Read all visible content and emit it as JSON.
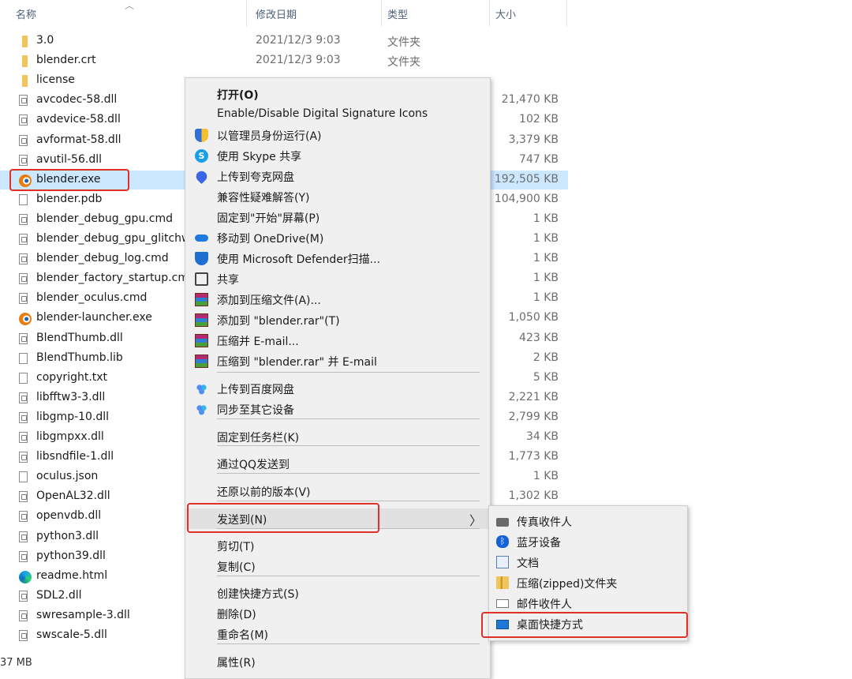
{
  "columns": {
    "name": "名称",
    "date": "修改日期",
    "type": "类型",
    "size": "大小"
  },
  "files": [
    {
      "name": "3.0",
      "date": "2021/12/3 9:03",
      "type": "文件夹",
      "size": "",
      "icon": "folder-icon"
    },
    {
      "name": "blender.crt",
      "date": "2021/12/3 9:03",
      "type": "文件夹",
      "size": "",
      "icon": "folder-icon"
    },
    {
      "name": "license",
      "date": "",
      "type": "",
      "size": "",
      "icon": "folder-icon"
    },
    {
      "name": "avcodec-58.dll",
      "date": "",
      "type": "",
      "size": "21,470 KB",
      "icon": "dll-file-icon"
    },
    {
      "name": "avdevice-58.dll",
      "date": "",
      "type": "",
      "size": "102 KB",
      "icon": "dll-file-icon"
    },
    {
      "name": "avformat-58.dll",
      "date": "",
      "type": "",
      "size": "3,379 KB",
      "icon": "dll-file-icon"
    },
    {
      "name": "avutil-56.dll",
      "date": "",
      "type": "",
      "size": "747 KB",
      "icon": "dll-file-icon"
    },
    {
      "name": "blender.exe",
      "date": "",
      "type": "",
      "size": "192,505 KB",
      "icon": "blender-icon"
    },
    {
      "name": "blender.pdb",
      "date": "",
      "type": "",
      "size": "104,900 KB",
      "icon": "file-icon"
    },
    {
      "name": "blender_debug_gpu.cmd",
      "date": "",
      "type": "",
      "size": "1 KB",
      "icon": "cmd-file-icon"
    },
    {
      "name": "blender_debug_gpu_glitchw",
      "date": "",
      "type": "",
      "size": "1 KB",
      "icon": "cmd-file-icon"
    },
    {
      "name": "blender_debug_log.cmd",
      "date": "",
      "type": "",
      "size": "1 KB",
      "icon": "cmd-file-icon"
    },
    {
      "name": "blender_factory_startup.cmc",
      "date": "",
      "type": "",
      "size": "1 KB",
      "icon": "cmd-file-icon"
    },
    {
      "name": "blender_oculus.cmd",
      "date": "",
      "type": "",
      "size": "1 KB",
      "icon": "cmd-file-icon"
    },
    {
      "name": "blender-launcher.exe",
      "date": "",
      "type": "",
      "size": "1,050 KB",
      "icon": "blender-icon"
    },
    {
      "name": "BlendThumb.dll",
      "date": "",
      "type": "",
      "size": "423 KB",
      "icon": "dll-file-icon"
    },
    {
      "name": "BlendThumb.lib",
      "date": "",
      "type": "",
      "size": "2 KB",
      "icon": "file-icon"
    },
    {
      "name": "copyright.txt",
      "date": "",
      "type": "",
      "size": "5 KB",
      "icon": "text-file-icon"
    },
    {
      "name": "libfftw3-3.dll",
      "date": "",
      "type": "",
      "size": "2,221 KB",
      "icon": "dll-file-icon"
    },
    {
      "name": "libgmp-10.dll",
      "date": "",
      "type": "",
      "size": "2,799 KB",
      "icon": "dll-file-icon"
    },
    {
      "name": "libgmpxx.dll",
      "date": "",
      "type": "",
      "size": "34 KB",
      "icon": "dll-file-icon"
    },
    {
      "name": "libsndfile-1.dll",
      "date": "",
      "type": "",
      "size": "1,773 KB",
      "icon": "dll-file-icon"
    },
    {
      "name": "oculus.json",
      "date": "",
      "type": "",
      "size": "1 KB",
      "icon": "file-icon"
    },
    {
      "name": "OpenAL32.dll",
      "date": "",
      "type": "",
      "size": "1,302 KB",
      "icon": "dll-file-icon"
    },
    {
      "name": "openvdb.dll",
      "date": "",
      "type": "",
      "size": "",
      "icon": "dll-file-icon"
    },
    {
      "name": "python3.dll",
      "date": "",
      "type": "",
      "size": "",
      "icon": "dll-file-icon"
    },
    {
      "name": "python39.dll",
      "date": "",
      "type": "",
      "size": "",
      "icon": "dll-file-icon"
    },
    {
      "name": "readme.html",
      "date": "",
      "type": "",
      "size": "",
      "icon": "edge-icon"
    },
    {
      "name": "SDL2.dll",
      "date": "",
      "type": "",
      "size": "",
      "icon": "dll-file-icon"
    },
    {
      "name": "swresample-3.dll",
      "date": "",
      "type": "",
      "size": "",
      "icon": "dll-file-icon"
    },
    {
      "name": "swscale-5.dll",
      "date": "",
      "type": "",
      "size": "",
      "icon": "dll-file-icon"
    }
  ],
  "status_text": "37 MB",
  "context_menu": [
    {
      "label": "打开(O)",
      "icon": "",
      "bold": true
    },
    {
      "label": "Enable/Disable Digital Signature Icons",
      "icon": ""
    },
    {
      "label": "以管理员身份运行(A)",
      "icon": "uac-shield-icon"
    },
    {
      "label": "使用 Skype 共享",
      "icon": "skype-icon"
    },
    {
      "label": "上传到夸克网盘",
      "icon": "quark-cloud-icon"
    },
    {
      "label": "兼容性疑难解答(Y)",
      "icon": ""
    },
    {
      "label": "固定到\"开始\"屏幕(P)",
      "icon": ""
    },
    {
      "label": "移动到 OneDrive(M)",
      "icon": "onedrive-icon"
    },
    {
      "label": "使用 Microsoft Defender扫描...",
      "icon": "defender-icon"
    },
    {
      "label": "共享",
      "icon": "share-icon"
    },
    {
      "label": "添加到压缩文件(A)...",
      "icon": "winrar-icon"
    },
    {
      "label": "添加到 \"blender.rar\"(T)",
      "icon": "winrar-icon"
    },
    {
      "label": "压缩并 E-mail...",
      "icon": "winrar-icon"
    },
    {
      "label": "压缩到 \"blender.rar\" 并 E-mail",
      "icon": "winrar-icon"
    },
    {
      "label": "上传到百度网盘",
      "icon": "baidu-netdisk-icon"
    },
    {
      "label": "同步至其它设备",
      "icon": "baidu-netdisk-icon"
    },
    {
      "label": "固定到任务栏(K)",
      "icon": ""
    },
    {
      "label": "通过QQ发送到",
      "icon": ""
    },
    {
      "label": "还原以前的版本(V)",
      "icon": ""
    },
    {
      "label": "发送到(N)",
      "icon": ""
    },
    {
      "label": "剪切(T)",
      "icon": ""
    },
    {
      "label": "复制(C)",
      "icon": ""
    },
    {
      "label": "创建快捷方式(S)",
      "icon": ""
    },
    {
      "label": "删除(D)",
      "icon": ""
    },
    {
      "label": "重命名(M)",
      "icon": ""
    },
    {
      "label": "属性(R)",
      "icon": ""
    }
  ],
  "submenu_arrow": "〉",
  "send_to_submenu": [
    {
      "label": "传真收件人",
      "icon": "fax-icon"
    },
    {
      "label": "蓝牙设备",
      "icon": "bluetooth-icon"
    },
    {
      "label": "文档",
      "icon": "documents-icon"
    },
    {
      "label": "压缩(zipped)文件夹",
      "icon": "zip-folder-icon"
    },
    {
      "label": "邮件收件人",
      "icon": "mail-icon"
    },
    {
      "label": "桌面快捷方式",
      "icon": "desktop-icon"
    }
  ],
  "colors": {
    "selection": "#cce8ff",
    "highlight_box": "#e0302a",
    "menu_bg": "#f0f0f0"
  }
}
